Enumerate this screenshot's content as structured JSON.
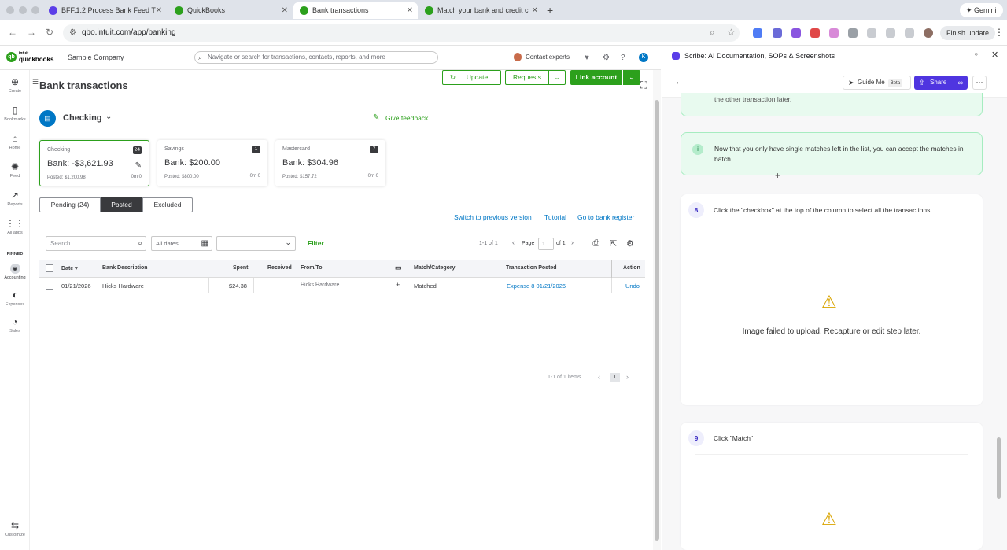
{
  "browser": {
    "tabs": [
      {
        "title": "BFF.1.2 Process Bank Feed T",
        "active": false,
        "favicon_color": "#5b3ee8"
      },
      {
        "title": "QuickBooks",
        "active": false,
        "favicon_color": "#2ca01c"
      },
      {
        "title": "Bank transactions",
        "active": true,
        "favicon_color": "#2ca01c"
      },
      {
        "title": "Match your bank and credit c",
        "active": false,
        "favicon_color": "#2ca01c"
      }
    ],
    "gemini_label": "Gemini",
    "url": "qbo.intuit.com/app/banking",
    "finish_update": "Finish update"
  },
  "qb_header": {
    "logo_top": "intuit",
    "logo_bottom": "quickbooks",
    "company": "Sample Company",
    "search_placeholder": "Navigate or search for transactions, contacts, reports, and more",
    "contact": "Contact experts",
    "avatar_letter": "K"
  },
  "leftnav": {
    "items": [
      {
        "label": "Create",
        "icon": "plus-circle-icon"
      },
      {
        "label": "Bookmarks",
        "icon": "bookmark-icon"
      },
      {
        "label": "Home",
        "icon": "home-icon"
      },
      {
        "label": "Feed",
        "icon": "feed-icon"
      },
      {
        "label": "Reports",
        "icon": "reports-icon"
      },
      {
        "label": "All apps",
        "icon": "grid-icon"
      }
    ],
    "pinned_label": "PINNED",
    "pinned": [
      {
        "label": "Accounting",
        "icon": "accounting-icon"
      },
      {
        "label": "Expenses",
        "icon": "expenses-icon"
      },
      {
        "label": "Sales",
        "icon": "sales-icon"
      }
    ],
    "customize": "Customize"
  },
  "page": {
    "title": "Bank transactions",
    "account": "Checking",
    "give_feedback": "Give feedback",
    "update": "Update",
    "requests": "Requests",
    "link_account": "Link account"
  },
  "cards": [
    {
      "name": "Checking",
      "badge": "24",
      "bank": "Bank: -$3,621.93",
      "posted": "Posted: $1,200.98",
      "mini": "0m  0"
    },
    {
      "name": "Savings",
      "badge": "1",
      "bank": "Bank: $200.00",
      "posted": "Posted: $800.00",
      "mini": "0m  0"
    },
    {
      "name": "Mastercard",
      "badge": "7",
      "bank": "Bank: $304.96",
      "posted": "Posted: $157.72",
      "mini": "0m  0"
    }
  ],
  "segments": [
    "Pending (24)",
    "Posted",
    "Excluded"
  ],
  "links": {
    "previous": "Switch to previous version",
    "tutorial": "Tutorial",
    "register": "Go to bank register"
  },
  "filters": {
    "search_placeholder": "Search",
    "dates": "All dates",
    "filter": "Filter",
    "range": "1-1 of 1",
    "page_label": "Page",
    "page_value": "1",
    "of_label": "of 1"
  },
  "table": {
    "headers": [
      "Date",
      "Bank Description",
      "Spent",
      "Received",
      "From/To",
      "Match/Category",
      "Transaction Posted",
      "Action"
    ],
    "rows": [
      {
        "date": "01/21/2026",
        "description": "Hicks Hardware",
        "spent": "$24.38",
        "received": "",
        "from_to": "Hicks Hardware",
        "match": "Matched",
        "posted": "Expense 8 01/21/2026",
        "action": "Undo"
      }
    ],
    "bottom_range": "1-1 of 1 items",
    "bottom_page": "1"
  },
  "scribe": {
    "title": "Scribe: AI Documentation, SOPs & Screenshots",
    "guide_me": "Guide Me",
    "beta": "Beta",
    "share": "Share",
    "prev_tip_tail": "the other transaction later.",
    "tip": "Now that you only have single matches left in the list, you can accept the matches in batch.",
    "steps": [
      {
        "num": "8",
        "text": "Click the \"checkbox\" at the top of the column to select all the transactions.",
        "fail": "Image failed to upload. Recapture or edit step later."
      },
      {
        "num": "9",
        "text": "Click \"Match\""
      }
    ]
  }
}
